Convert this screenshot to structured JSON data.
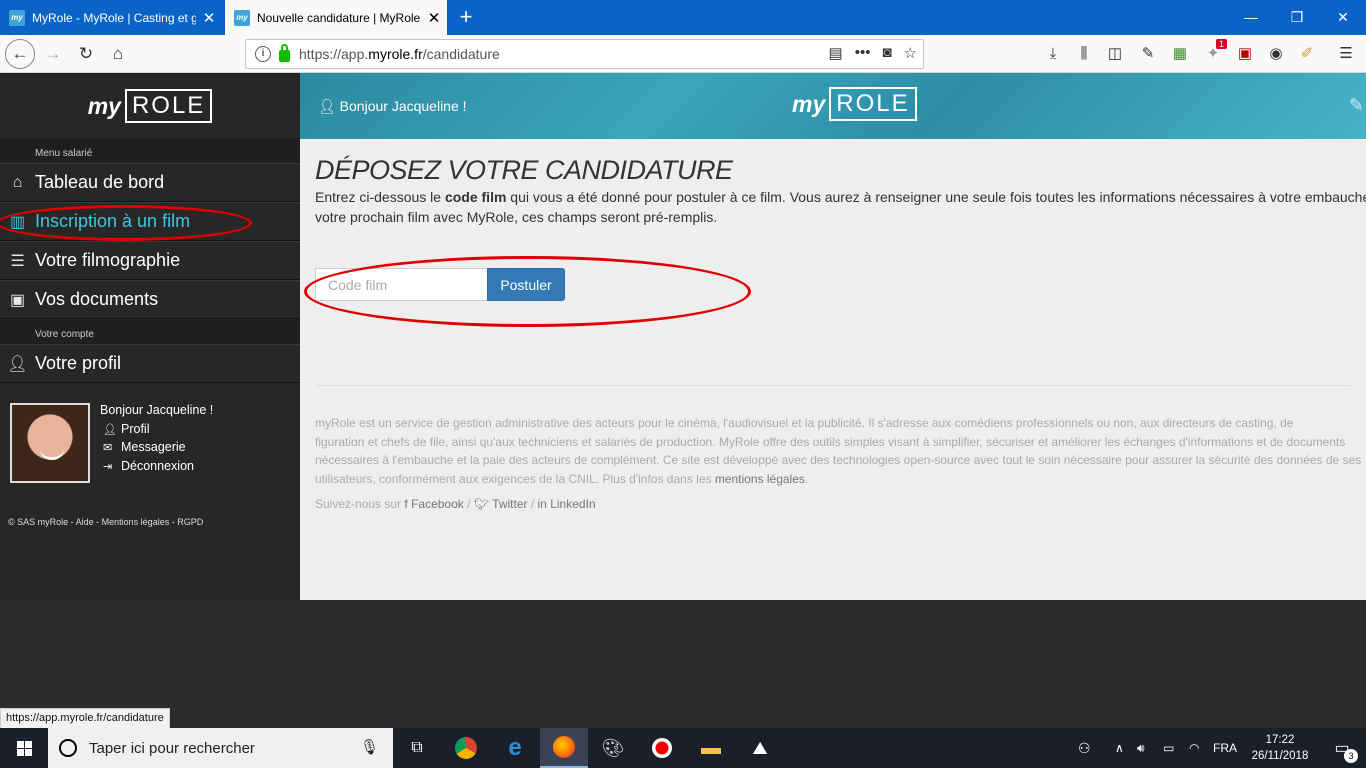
{
  "browser": {
    "tabs": [
      {
        "title": "MyRole - MyRole | Casting et g",
        "favicon": "my"
      },
      {
        "title": "Nouvelle candidature | MyRole",
        "favicon": "my"
      }
    ],
    "url_prefix": "https://app.",
    "url_domain": "myrole.fr",
    "url_path": "/candidature",
    "toolbar_badge": "1",
    "status_url": "https://app.myrole.fr/candidature"
  },
  "sidebar": {
    "logo_my": "my",
    "logo_role": "ROLE",
    "section_employee": "Menu salarié",
    "items": [
      {
        "label": "Tableau de bord",
        "icon": "home-icon"
      },
      {
        "label": "Inscription à un film",
        "icon": "film-icon",
        "active": true
      },
      {
        "label": "Votre filmographie",
        "icon": "list-icon"
      },
      {
        "label": "Vos documents",
        "icon": "briefcase-icon"
      }
    ],
    "section_account": "Votre compte",
    "profile_label": "Votre profil",
    "user": {
      "greeting": "Bonjour Jacqueline !",
      "profil": "Profil",
      "messagerie": "Messagerie",
      "deconnexion": "Déconnexion"
    },
    "footer": "© SAS myRole -  Aide - Mentions légales - RGPD"
  },
  "banner": {
    "greeting": "Bonjour Jacqueline !",
    "logo_my": "my",
    "logo_role": "ROLE"
  },
  "main": {
    "title": "DÉPOSEZ VOTRE CANDIDATURE",
    "intro_part1": "Entrez ci-dessous le ",
    "intro_bold": "code film",
    "intro_part2": " qui vous a été donné pour postuler à ce film. Vous aurez à renseigner une seule fois toutes les informations nécessaires à votre embauche. Pour",
    "intro_line2": "votre prochain film avec MyRole, ces champs seront pré-remplis.",
    "code_placeholder": "Code film",
    "submit_label": "Postuler"
  },
  "footer": {
    "line1": "myRole est un service de gestion administrative des acteurs pour le cinéma, l'audiovisuel et la publicité. Il s'adresse aux comédiens professionnels ou non, aux directeurs de casting, de",
    "line2": "figuration et chefs de file, ainsi qu'aux techniciens et salariés de production. MyRole offre des outils simples visant à simplifier, sécuriser et améliorer les échanges d'informations et de documents",
    "line3": "nécessaires à l'embauche et la paie des acteurs de complément. Ce site est développé avec des technologies open-source avec tout le soin nécessaire pour assurer la sécurité des données de ses",
    "line4_prefix": "utilisateurs, conformément aux exigences de la CNIL. Plus d'infos dans les ",
    "line4_link": "mentions légales",
    "line4_suffix": ".",
    "follow_prefix": "Suivez-nous sur",
    "facebook": "Facebook",
    "twitter": "Twitter",
    "linkedin": "LinkedIn"
  },
  "taskbar": {
    "search_placeholder": "Taper ici pour rechercher",
    "language": "FRA",
    "time": "17:22",
    "date": "26/11/2018",
    "notification_count": "3"
  },
  "colors": {
    "accent": "#3ec6e0",
    "button": "#337ab7",
    "highlight": "#e00000",
    "tabbar": "#0a64c7"
  }
}
